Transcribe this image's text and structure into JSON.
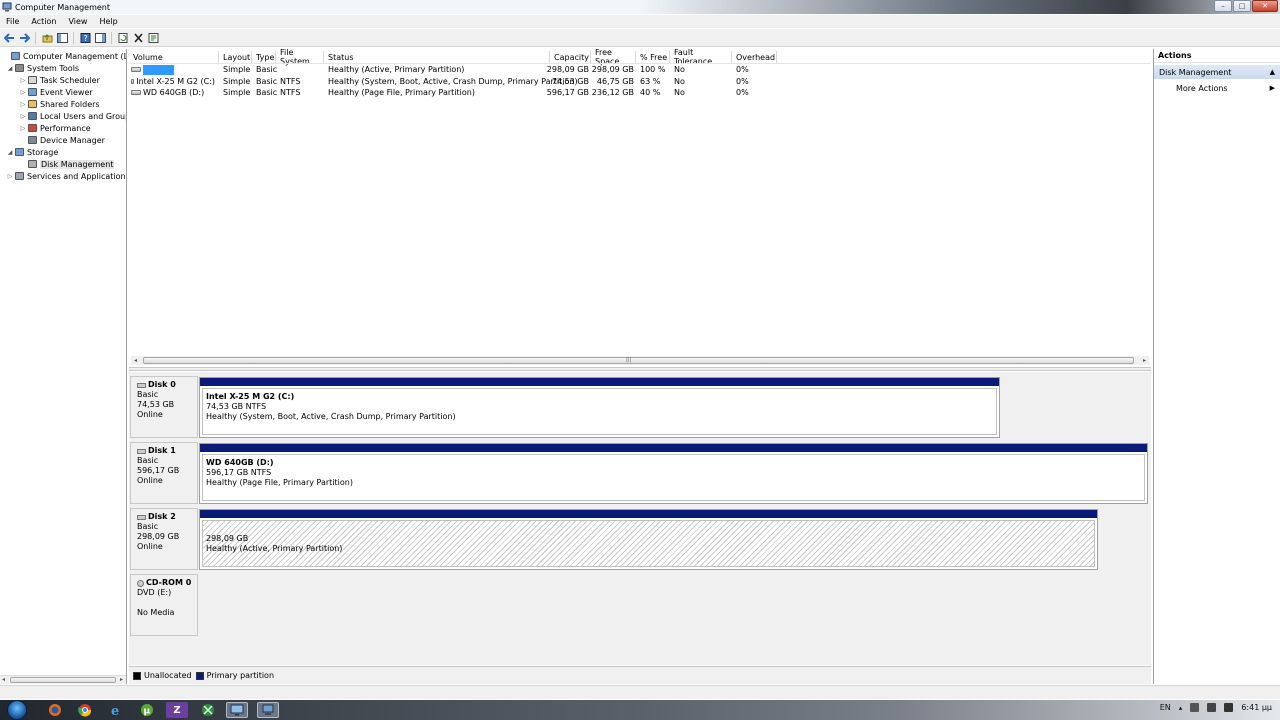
{
  "window": {
    "title": "Computer Management",
    "controls": [
      "–",
      "□",
      "✕"
    ]
  },
  "menu": [
    "File",
    "Action",
    "View",
    "Help"
  ],
  "tree": {
    "items": [
      {
        "label": "Computer Management (Local",
        "indent": 0,
        "expander": "",
        "icon": "computer-icon"
      },
      {
        "label": "System Tools",
        "indent": 1,
        "expander": "◢",
        "icon": "tools-icon"
      },
      {
        "label": "Task Scheduler",
        "indent": 2,
        "expander": "▷",
        "icon": "clock-icon"
      },
      {
        "label": "Event Viewer",
        "indent": 2,
        "expander": "▷",
        "icon": "event-viewer-icon"
      },
      {
        "label": "Shared Folders",
        "indent": 2,
        "expander": "▷",
        "icon": "folder-icon"
      },
      {
        "label": "Local Users and Groups",
        "indent": 2,
        "expander": "▷",
        "icon": "users-icon"
      },
      {
        "label": "Performance",
        "indent": 2,
        "expander": "▷",
        "icon": "performance-icon"
      },
      {
        "label": "Device Manager",
        "indent": 2,
        "expander": "",
        "icon": "device-manager-icon"
      },
      {
        "label": "Storage",
        "indent": 1,
        "expander": "◢",
        "icon": "storage-icon"
      },
      {
        "label": "Disk Management",
        "indent": 2,
        "expander": "",
        "icon": "disk-icon",
        "selected": true
      },
      {
        "label": "Services and Applications",
        "indent": 1,
        "expander": "▷",
        "icon": "services-icon"
      }
    ]
  },
  "volumes": {
    "headers": [
      "Volume",
      "Layout",
      "Type",
      "File System",
      "Status",
      "Capacity",
      "Free Space",
      "% Free",
      "Fault Tolerance",
      "Overhead"
    ],
    "rows": [
      {
        "volume": "",
        "layout": "Simple",
        "type": "Basic",
        "fs": "",
        "status": "Healthy (Active, Primary Partition)",
        "capacity": "298,09 GB",
        "free": "298,09 GB",
        "pct": "100 %",
        "fault": "No",
        "overhead": "0%"
      },
      {
        "volume": "Intel X-25 M G2 (C:)",
        "layout": "Simple",
        "type": "Basic",
        "fs": "NTFS",
        "status": "Healthy (System, Boot, Active, Crash Dump, Primary Partition)",
        "capacity": "74,53 GB",
        "free": "46,75 GB",
        "pct": "63 %",
        "fault": "No",
        "overhead": "0%"
      },
      {
        "volume": "WD 640GB (D:)",
        "layout": "Simple",
        "type": "Basic",
        "fs": "NTFS",
        "status": "Healthy (Page File, Primary Partition)",
        "capacity": "596,17 GB",
        "free": "236,12 GB",
        "pct": "40 %",
        "fault": "No",
        "overhead": "0%"
      }
    ]
  },
  "disks": [
    {
      "name": "Disk 0",
      "type": "Basic",
      "size": "74,53 GB",
      "state": "Online",
      "partition": {
        "name": "Intel X-25 M G2  (C:)",
        "size": "74,53 GB NTFS",
        "status": "Healthy (System, Boot, Active, Crash Dump, Primary Partition)"
      }
    },
    {
      "name": "Disk 1",
      "type": "Basic",
      "size": "596,17 GB",
      "state": "Online",
      "partition": {
        "name": "WD 640GB  (D:)",
        "size": "596,17 GB NTFS",
        "status": "Healthy (Page File, Primary Partition)"
      }
    },
    {
      "name": "Disk 2",
      "type": "Basic",
      "size": "298,09 GB",
      "state": "Online",
      "partition": {
        "name": "",
        "size": "298,09 GB",
        "status": "Healthy (Active, Primary Partition)"
      }
    },
    {
      "name": "CD-ROM 0",
      "type": "DVD (E:)",
      "size": "",
      "state": "No Media"
    }
  ],
  "legend": [
    {
      "label": "Unallocated",
      "color": "#000000"
    },
    {
      "label": "Primary partition",
      "color": "#0a1a78"
    }
  ],
  "actions": {
    "title": "Actions",
    "section": "Disk Management",
    "items": [
      "More Actions"
    ]
  },
  "taskbar": {
    "tray_lang": "EN",
    "clock": "6:41 μμ"
  }
}
